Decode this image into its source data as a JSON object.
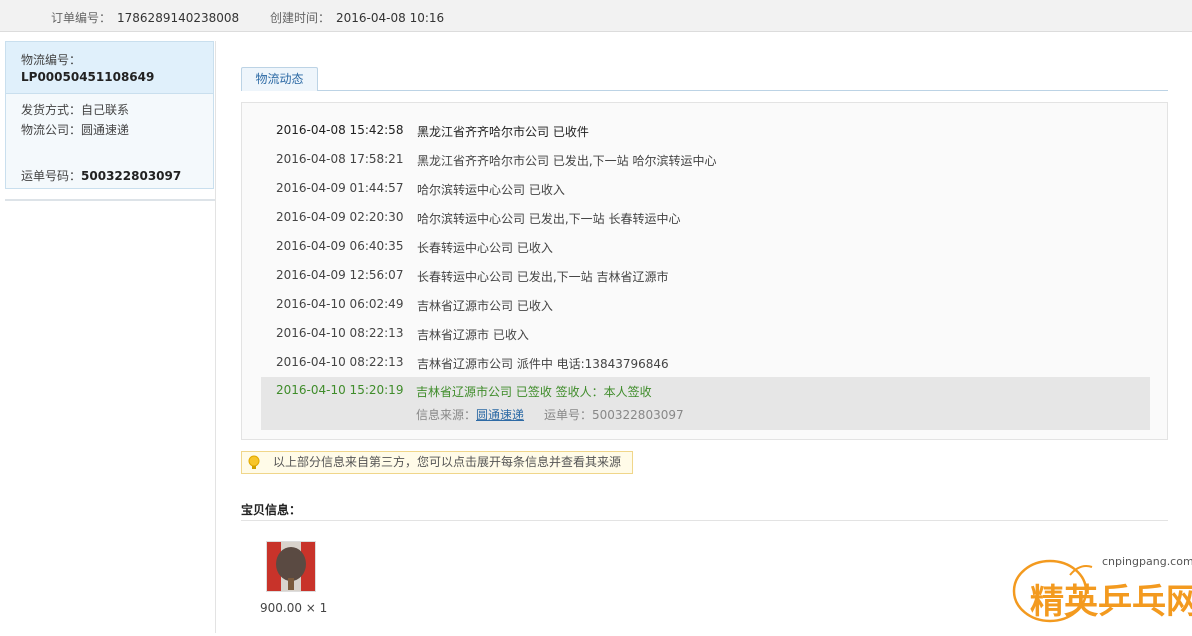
{
  "order": {
    "number_label": "订单编号：",
    "number_value": "1786289140238008",
    "created_label": "创建时间：",
    "created_value": "2016-04-08 10:16"
  },
  "logistics": {
    "id_label": "物流编号：",
    "id_value": "LP00050451108649",
    "ship_method": "发货方式：自己联系",
    "company": "物流公司：圆通速递",
    "waybill_label": "运单号码：",
    "waybill_value": "500322803097"
  },
  "tab_label": "物流动态",
  "events": [
    {
      "time": "2016-04-08 15:42:58",
      "msg": "黑龙江省齐齐哈尔市公司 已收件"
    },
    {
      "time": "2016-04-08 17:58:21",
      "msg": "黑龙江省齐齐哈尔市公司 已发出,下一站 哈尔滨转运中心"
    },
    {
      "time": "2016-04-09 01:44:57",
      "msg": "哈尔滨转运中心公司 已收入"
    },
    {
      "time": "2016-04-09 02:20:30",
      "msg": "哈尔滨转运中心公司 已发出,下一站 长春转运中心"
    },
    {
      "time": "2016-04-09 06:40:35",
      "msg": "长春转运中心公司 已收入"
    },
    {
      "time": "2016-04-09 12:56:07",
      "msg": "长春转运中心公司 已发出,下一站 吉林省辽源市"
    },
    {
      "time": "2016-04-10 06:02:49",
      "msg": "吉林省辽源市公司 已收入"
    },
    {
      "time": "2016-04-10 08:22:13",
      "msg": "吉林省辽源市 已收入"
    },
    {
      "time": "2016-04-10 08:22:13",
      "msg": "吉林省辽源市公司 派件中 电话:13843796846"
    }
  ],
  "last_event": {
    "time": "2016-04-10 15:20:19",
    "msg": "吉林省辽源市公司 已签收 签收人：本人签收",
    "source_label": "信息来源：",
    "source_link": "圆通速递",
    "waybill": "运单号：500322803097"
  },
  "tip": "以上部分信息来自第三方，您可以点击展开每条信息并查看其来源",
  "item_section_title": "宝贝信息：",
  "item_price": "900.00 × 1",
  "watermark": {
    "url": "cnpingpang.com",
    "text": "精英乒乓网"
  },
  "colors": {
    "accent_blue": "#2d6aa5",
    "signed_green": "#3f8c2a",
    "tip_border": "#f0d68a"
  }
}
